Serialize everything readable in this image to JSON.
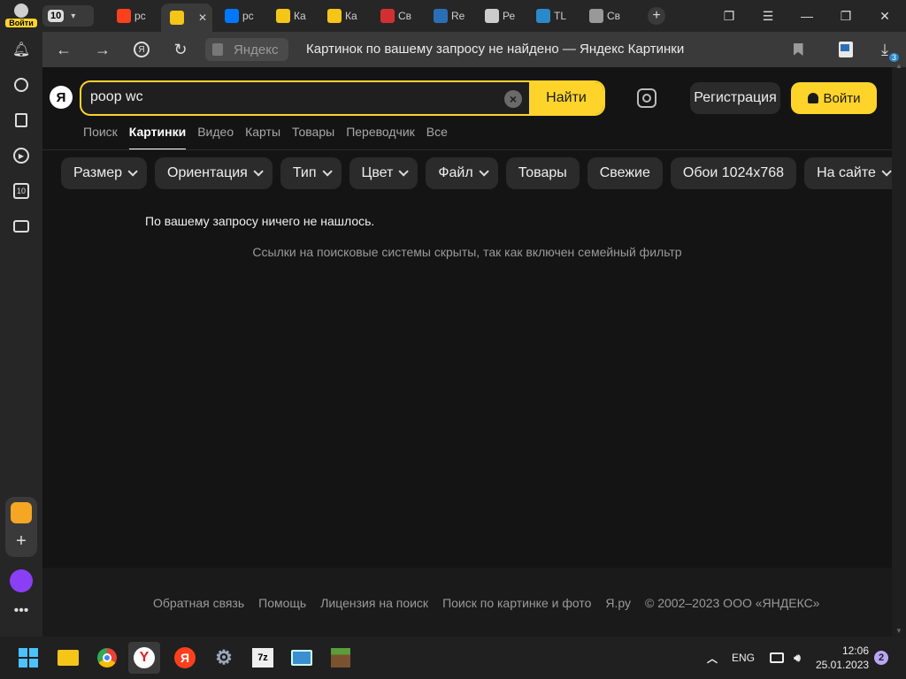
{
  "profile": {
    "label": "Войти"
  },
  "tab_count": "10",
  "tabs": [
    {
      "label": "рс",
      "icon": "yandex-icon",
      "color": "#fc3f1d"
    },
    {
      "label": "",
      "icon": "images-icon",
      "color": "#f5c518"
    },
    {
      "label": "рс",
      "icon": "vk-icon",
      "color": "#0077ff"
    },
    {
      "label": "Ка",
      "icon": "images-icon",
      "color": "#f5c518"
    },
    {
      "label": "Ка",
      "icon": "images-icon",
      "color": "#f5c518"
    },
    {
      "label": "Св",
      "icon": "app-icon",
      "color": "#d23030"
    },
    {
      "label": "Re",
      "icon": "app-icon",
      "color": "#2a6fb5"
    },
    {
      "label": "Ре",
      "icon": "apple-icon",
      "color": "#cccccc"
    },
    {
      "label": "TL",
      "icon": "tl-icon",
      "color": "#2a89c9"
    },
    {
      "label": "Св",
      "icon": "box-icon",
      "color": "#999999"
    }
  ],
  "address": {
    "domain": "Яндекс",
    "title": "Картинок по вашему запросу не найдено — Яндекс Картинки",
    "downloads_badge": "3"
  },
  "search": {
    "logo": "Я",
    "query": "poop wc",
    "submit_label": "Найти"
  },
  "auth": {
    "register_label": "Регистрация",
    "login_label": "Войти"
  },
  "services": [
    "Поиск",
    "Картинки",
    "Видео",
    "Карты",
    "Товары",
    "Переводчик",
    "Все"
  ],
  "filters": [
    {
      "label": "Размер",
      "dropdown": true
    },
    {
      "label": "Ориентация",
      "dropdown": true
    },
    {
      "label": "Тип",
      "dropdown": true
    },
    {
      "label": "Цвет",
      "dropdown": true
    },
    {
      "label": "Файл",
      "dropdown": true
    },
    {
      "label": "Товары",
      "dropdown": false
    },
    {
      "label": "Свежие",
      "dropdown": false
    },
    {
      "label": "Обои 1024х768",
      "dropdown": false
    },
    {
      "label": "На сайте",
      "dropdown": true
    }
  ],
  "message": {
    "no_results": "По вашему запросу ничего не нашлось.",
    "family_filter": "Ссылки на поисковые системы скрыты, так как включен семейный фильтр"
  },
  "footer": {
    "links": [
      "Обратная связь",
      "Помощь",
      "Лицензия на поиск",
      "Поиск по картинке и фото",
      "Я.ру"
    ],
    "copyright": "© 2002–2023 ООО «ЯНДЕКС»"
  },
  "taskbar": {
    "lang": "ENG",
    "time": "12:06",
    "date": "25.01.2023",
    "notifications": "2"
  },
  "colors": {
    "accent": "#fed42b",
    "background": "#141414"
  }
}
